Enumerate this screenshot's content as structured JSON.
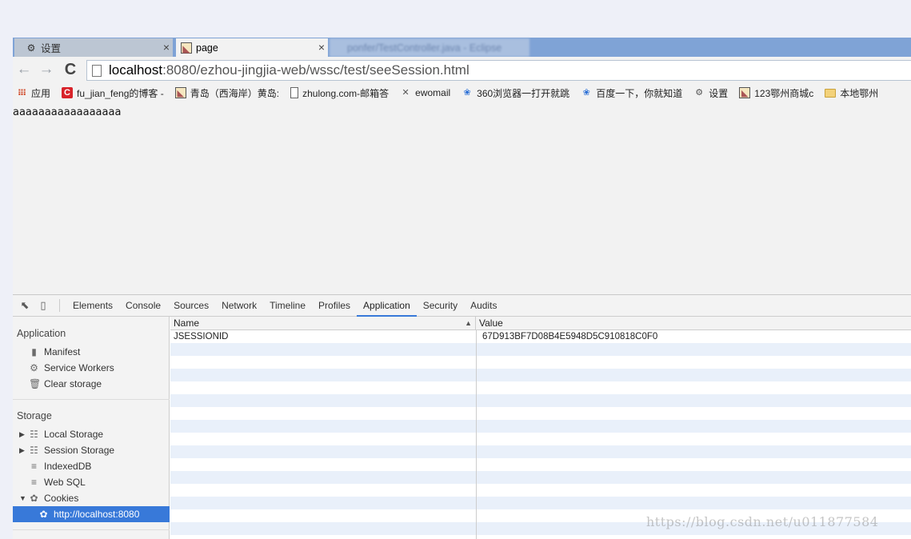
{
  "tabs": [
    {
      "label": "设置",
      "icon": "gear-icon",
      "active": false
    },
    {
      "label": "page",
      "icon": "page-favicon",
      "active": true
    },
    {
      "label": "ponfer/TestController.java - Eclipse",
      "icon": "eclipse-icon",
      "active": false
    }
  ],
  "address": {
    "host": "localhost",
    "rest": ":8080/ezhou-jingjia-web/wssc/test/seeSession.html"
  },
  "bookmarks": [
    {
      "label": "应用",
      "icon": "apps-icon"
    },
    {
      "label": "fu_jian_feng的博客 -",
      "icon": "csdn-icon"
    },
    {
      "label": "青岛（西海岸）黄岛:",
      "icon": "image-icon"
    },
    {
      "label": "zhulong.com-邮箱答",
      "icon": "doc-icon"
    },
    {
      "label": "ewomail",
      "icon": "mail-icon"
    },
    {
      "label": "360浏览器一打开就跳",
      "icon": "paw-icon"
    },
    {
      "label": "百度一下，你就知道",
      "icon": "paw-icon"
    },
    {
      "label": "设置",
      "icon": "gear-icon"
    },
    {
      "label": "123鄂州商城c",
      "icon": "image-icon"
    },
    {
      "label": "本地鄂州",
      "icon": "folder-icon"
    }
  ],
  "page": {
    "text": "aaaaaaaaaaaaaaaaa"
  },
  "devtools": {
    "tabs": [
      "Elements",
      "Console",
      "Sources",
      "Network",
      "Timeline",
      "Profiles",
      "Application",
      "Security",
      "Audits"
    ],
    "active_tab": "Application",
    "sidebar": {
      "application_title": "Application",
      "application_items": [
        {
          "label": "Manifest",
          "icon": "file-icon"
        },
        {
          "label": "Service Workers",
          "icon": "gear-icon"
        },
        {
          "label": "Clear storage",
          "icon": "trash-icon"
        }
      ],
      "storage_title": "Storage",
      "storage_items": [
        {
          "label": "Local Storage",
          "icon": "grid-icon",
          "expandable": "collapsed"
        },
        {
          "label": "Session Storage",
          "icon": "grid-icon",
          "expandable": "collapsed"
        },
        {
          "label": "IndexedDB",
          "icon": "database-icon"
        },
        {
          "label": "Web SQL",
          "icon": "database-icon"
        },
        {
          "label": "Cookies",
          "icon": "cookie-icon",
          "expandable": "expanded"
        }
      ],
      "selected_item": {
        "label": "http://localhost:8080",
        "icon": "cookie-icon"
      }
    },
    "table": {
      "columns": [
        "Name",
        "Value"
      ],
      "rows": [
        {
          "name": "JSESSIONID",
          "value": "67D913BF7D08B4E5948D5C910818C0F0"
        }
      ]
    }
  },
  "watermark": "https://blog.csdn.net/u011877584"
}
